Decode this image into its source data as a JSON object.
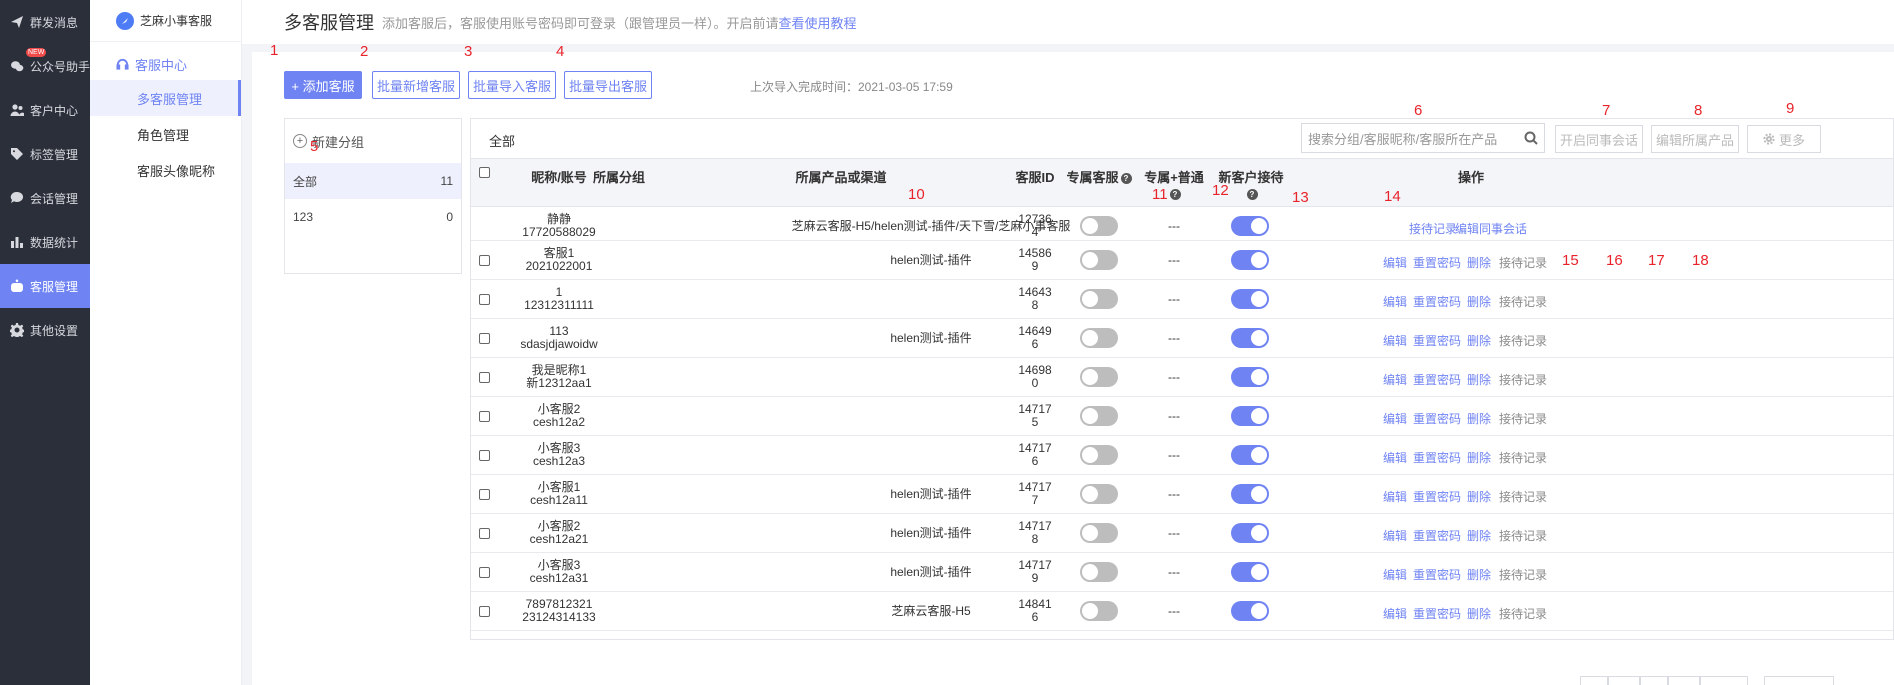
{
  "nav": {
    "items": [
      {
        "label": "群发消息",
        "icon": "send-icon"
      },
      {
        "label": "公众号助手",
        "icon": "wechat-icon",
        "badge": "NEW"
      },
      {
        "label": "客户中心",
        "icon": "users-icon"
      },
      {
        "label": "标签管理",
        "icon": "tag-icon"
      },
      {
        "label": "会话管理",
        "icon": "chat-icon"
      },
      {
        "label": "数据统计",
        "icon": "bar-chart-icon"
      },
      {
        "label": "客服管理",
        "icon": "robot-icon",
        "active": true
      },
      {
        "label": "其他设置",
        "icon": "gear-icon"
      }
    ]
  },
  "subnav": {
    "brand": "芝麻小事客服",
    "group": "客服中心",
    "items": [
      "多客服管理",
      "角色管理",
      "客服头像昵称"
    ]
  },
  "header": {
    "title": "多客服管理",
    "desc": "添加客服后，客服使用账号密码即可登录（跟管理员一样）。开启前请",
    "link": "查看使用教程"
  },
  "toolbar": {
    "add": "+ 添加客服",
    "batch_add": "批量新增客服",
    "batch_import": "批量导入客服",
    "batch_export": "批量导出客服",
    "last_import": "上次导入完成时间：2021-03-05 17:59"
  },
  "groups": {
    "new_group": "新建分组",
    "list": [
      {
        "name": "全部",
        "count": "11"
      },
      {
        "name": "123",
        "count": "0"
      }
    ]
  },
  "table": {
    "tab": "全部",
    "search_placeholder": "搜索分组/客服昵称/客服所在产品",
    "btn_colleague": "开启同事会话",
    "btn_edit_product": "编辑所属产品",
    "btn_more": "更多",
    "headers": {
      "name": "昵称/账号",
      "group": "所属分组",
      "product": "所属产品或渠道",
      "id": "客服ID",
      "exclusive": "专属客服",
      "exclusive_plus": "专属+普通",
      "new_customer": "新客户接待",
      "actions": "操作"
    },
    "row_actions": {
      "edit": "编辑",
      "reset": "重置密码",
      "delete": "删除",
      "records": "接待记录",
      "colleague": "编辑同事会话"
    },
    "rows": [
      {
        "nick": "静静",
        "account": "17720588029",
        "product": "芝麻云客服-H5/helen测试-插件/天下雪/芝麻小事客服",
        "id1": "12736",
        "id2": "4",
        "exclusive": false,
        "plus": "---",
        "new_customer": true,
        "type": "admin"
      },
      {
        "nick": "客服1",
        "account": "2021022001",
        "product": "helen测试-插件",
        "id1": "14586",
        "id2": "9",
        "exclusive": false,
        "plus": "---",
        "new_customer": true
      },
      {
        "nick": "1",
        "account": "12312311111",
        "product": "",
        "id1": "14643",
        "id2": "8",
        "exclusive": false,
        "plus": "---",
        "new_customer": true
      },
      {
        "nick": "113",
        "account": "sdasjdjawoidw",
        "product": "helen测试-插件",
        "id1": "14649",
        "id2": "6",
        "exclusive": false,
        "plus": "---",
        "new_customer": true
      },
      {
        "nick": "我是昵称1",
        "account": "新12312aa1",
        "product": "",
        "id1": "14698",
        "id2": "0",
        "exclusive": false,
        "plus": "---",
        "new_customer": true
      },
      {
        "nick": "小客服2",
        "account": "cesh12a2",
        "product": "",
        "id1": "14717",
        "id2": "5",
        "exclusive": false,
        "plus": "---",
        "new_customer": true
      },
      {
        "nick": "小客服3",
        "account": "cesh12a3",
        "product": "",
        "id1": "14717",
        "id2": "6",
        "exclusive": false,
        "plus": "---",
        "new_customer": true
      },
      {
        "nick": "小客服1",
        "account": "cesh12a11",
        "product": "helen测试-插件",
        "id1": "14717",
        "id2": "7",
        "exclusive": false,
        "plus": "---",
        "new_customer": true
      },
      {
        "nick": "小客服2",
        "account": "cesh12a21",
        "product": "helen测试-插件",
        "id1": "14717",
        "id2": "8",
        "exclusive": false,
        "plus": "---",
        "new_customer": true
      },
      {
        "nick": "小客服3",
        "account": "cesh12a31",
        "product": "helen测试-插件",
        "id1": "14717",
        "id2": "9",
        "exclusive": false,
        "plus": "---",
        "new_customer": true
      },
      {
        "nick": "7897812321",
        "account": "23124314133",
        "product": "芝麻云客服-H5",
        "id1": "14841",
        "id2": "6",
        "exclusive": false,
        "plus": "---",
        "new_customer": true
      }
    ]
  },
  "annotations": [
    "1",
    "2",
    "3",
    "4",
    "5",
    "6",
    "7",
    "8",
    "9",
    "10",
    "11",
    "12",
    "13",
    "14",
    "15",
    "16",
    "17",
    "18"
  ]
}
